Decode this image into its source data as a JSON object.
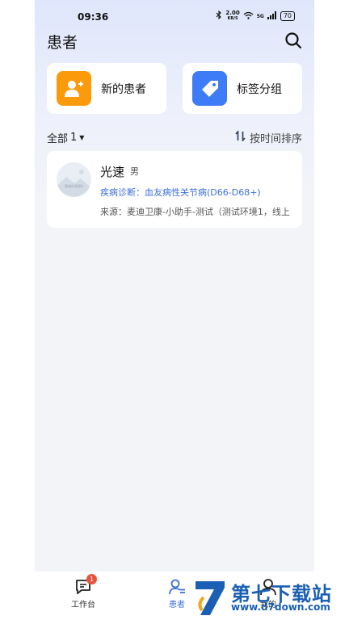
{
  "status_bar": {
    "time": "09:36",
    "net_speed_value": "2.00",
    "net_speed_unit": "KB/S",
    "signal_label": "5G",
    "battery": "70"
  },
  "header": {
    "title": "患者"
  },
  "actions": [
    {
      "label": "新的患者",
      "icon": "add-user-icon",
      "color": "#fb9a0a"
    },
    {
      "label": "标签分组",
      "icon": "tag-icon",
      "color": "#3d7cf6"
    }
  ],
  "filter": {
    "label": "全部",
    "count": "1",
    "sort_label": "按时间排序"
  },
  "patients": [
    {
      "avatar_text": "患者信息图片",
      "name": "光速",
      "gender": "男",
      "diagnosis": "疾病诊断：血友病性关节病(D66-D68+)",
      "source": "来源：麦迪卫康-小助手-测试（测试环境1，线上"
    }
  ],
  "tabs": [
    {
      "label": "工作台",
      "icon": "chat-icon",
      "badge": "1",
      "active": false
    },
    {
      "label": "患者",
      "icon": "patient-icon",
      "active": true
    },
    {
      "label": "我的",
      "icon": "user-icon",
      "active": false
    }
  ],
  "watermark": {
    "text": "第七下载站",
    "url": "www.d7down.com"
  },
  "colors": {
    "accent": "#3d6fd8",
    "orange": "#fb9a0a",
    "badge": "#e8533c"
  }
}
